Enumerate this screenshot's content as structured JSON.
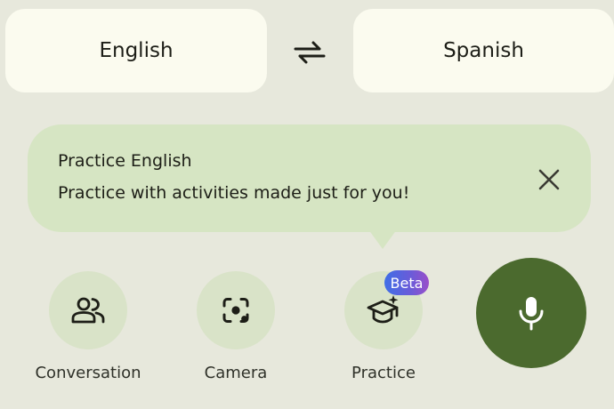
{
  "languages": {
    "source": "English",
    "target": "Spanish"
  },
  "tooltip": {
    "title": "Practice English",
    "body": "Practice with activities made just for you!"
  },
  "actions": {
    "conversation": "Conversation",
    "camera": "Camera",
    "practice": "Practice",
    "practice_badge": "Beta"
  },
  "icons": {
    "swap": "swap-arrows-icon",
    "close": "close-icon",
    "conversation": "people-icon",
    "camera": "camera-lens-icon",
    "practice": "graduation-cap-sparkle-icon",
    "mic": "microphone-icon"
  },
  "colors": {
    "background": "#e7e8dc",
    "language_button": "#fbfbef",
    "tooltip": "#d6e5c3",
    "action_circle": "#d9e3c8",
    "mic_button": "#4b6a2e"
  }
}
